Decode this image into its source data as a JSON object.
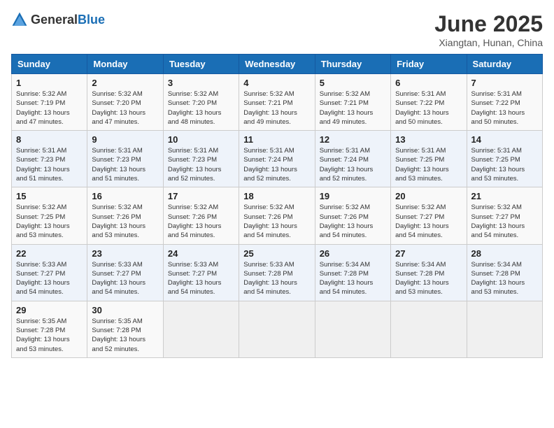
{
  "logo": {
    "general": "General",
    "blue": "Blue"
  },
  "title": "June 2025",
  "subtitle": "Xiangtan, Hunan, China",
  "days_of_week": [
    "Sunday",
    "Monday",
    "Tuesday",
    "Wednesday",
    "Thursday",
    "Friday",
    "Saturday"
  ],
  "weeks": [
    [
      {
        "day": "1",
        "info": "Sunrise: 5:32 AM\nSunset: 7:19 PM\nDaylight: 13 hours\nand 47 minutes."
      },
      {
        "day": "2",
        "info": "Sunrise: 5:32 AM\nSunset: 7:20 PM\nDaylight: 13 hours\nand 47 minutes."
      },
      {
        "day": "3",
        "info": "Sunrise: 5:32 AM\nSunset: 7:20 PM\nDaylight: 13 hours\nand 48 minutes."
      },
      {
        "day": "4",
        "info": "Sunrise: 5:32 AM\nSunset: 7:21 PM\nDaylight: 13 hours\nand 49 minutes."
      },
      {
        "day": "5",
        "info": "Sunrise: 5:32 AM\nSunset: 7:21 PM\nDaylight: 13 hours\nand 49 minutes."
      },
      {
        "day": "6",
        "info": "Sunrise: 5:31 AM\nSunset: 7:22 PM\nDaylight: 13 hours\nand 50 minutes."
      },
      {
        "day": "7",
        "info": "Sunrise: 5:31 AM\nSunset: 7:22 PM\nDaylight: 13 hours\nand 50 minutes."
      }
    ],
    [
      {
        "day": "8",
        "info": "Sunrise: 5:31 AM\nSunset: 7:23 PM\nDaylight: 13 hours\nand 51 minutes."
      },
      {
        "day": "9",
        "info": "Sunrise: 5:31 AM\nSunset: 7:23 PM\nDaylight: 13 hours\nand 51 minutes."
      },
      {
        "day": "10",
        "info": "Sunrise: 5:31 AM\nSunset: 7:23 PM\nDaylight: 13 hours\nand 52 minutes."
      },
      {
        "day": "11",
        "info": "Sunrise: 5:31 AM\nSunset: 7:24 PM\nDaylight: 13 hours\nand 52 minutes."
      },
      {
        "day": "12",
        "info": "Sunrise: 5:31 AM\nSunset: 7:24 PM\nDaylight: 13 hours\nand 52 minutes."
      },
      {
        "day": "13",
        "info": "Sunrise: 5:31 AM\nSunset: 7:25 PM\nDaylight: 13 hours\nand 53 minutes."
      },
      {
        "day": "14",
        "info": "Sunrise: 5:31 AM\nSunset: 7:25 PM\nDaylight: 13 hours\nand 53 minutes."
      }
    ],
    [
      {
        "day": "15",
        "info": "Sunrise: 5:32 AM\nSunset: 7:25 PM\nDaylight: 13 hours\nand 53 minutes."
      },
      {
        "day": "16",
        "info": "Sunrise: 5:32 AM\nSunset: 7:26 PM\nDaylight: 13 hours\nand 53 minutes."
      },
      {
        "day": "17",
        "info": "Sunrise: 5:32 AM\nSunset: 7:26 PM\nDaylight: 13 hours\nand 54 minutes."
      },
      {
        "day": "18",
        "info": "Sunrise: 5:32 AM\nSunset: 7:26 PM\nDaylight: 13 hours\nand 54 minutes."
      },
      {
        "day": "19",
        "info": "Sunrise: 5:32 AM\nSunset: 7:26 PM\nDaylight: 13 hours\nand 54 minutes."
      },
      {
        "day": "20",
        "info": "Sunrise: 5:32 AM\nSunset: 7:27 PM\nDaylight: 13 hours\nand 54 minutes."
      },
      {
        "day": "21",
        "info": "Sunrise: 5:32 AM\nSunset: 7:27 PM\nDaylight: 13 hours\nand 54 minutes."
      }
    ],
    [
      {
        "day": "22",
        "info": "Sunrise: 5:33 AM\nSunset: 7:27 PM\nDaylight: 13 hours\nand 54 minutes."
      },
      {
        "day": "23",
        "info": "Sunrise: 5:33 AM\nSunset: 7:27 PM\nDaylight: 13 hours\nand 54 minutes."
      },
      {
        "day": "24",
        "info": "Sunrise: 5:33 AM\nSunset: 7:27 PM\nDaylight: 13 hours\nand 54 minutes."
      },
      {
        "day": "25",
        "info": "Sunrise: 5:33 AM\nSunset: 7:28 PM\nDaylight: 13 hours\nand 54 minutes."
      },
      {
        "day": "26",
        "info": "Sunrise: 5:34 AM\nSunset: 7:28 PM\nDaylight: 13 hours\nand 54 minutes."
      },
      {
        "day": "27",
        "info": "Sunrise: 5:34 AM\nSunset: 7:28 PM\nDaylight: 13 hours\nand 53 minutes."
      },
      {
        "day": "28",
        "info": "Sunrise: 5:34 AM\nSunset: 7:28 PM\nDaylight: 13 hours\nand 53 minutes."
      }
    ],
    [
      {
        "day": "29",
        "info": "Sunrise: 5:35 AM\nSunset: 7:28 PM\nDaylight: 13 hours\nand 53 minutes."
      },
      {
        "day": "30",
        "info": "Sunrise: 5:35 AM\nSunset: 7:28 PM\nDaylight: 13 hours\nand 52 minutes."
      },
      {
        "day": "",
        "info": ""
      },
      {
        "day": "",
        "info": ""
      },
      {
        "day": "",
        "info": ""
      },
      {
        "day": "",
        "info": ""
      },
      {
        "day": "",
        "info": ""
      }
    ]
  ]
}
